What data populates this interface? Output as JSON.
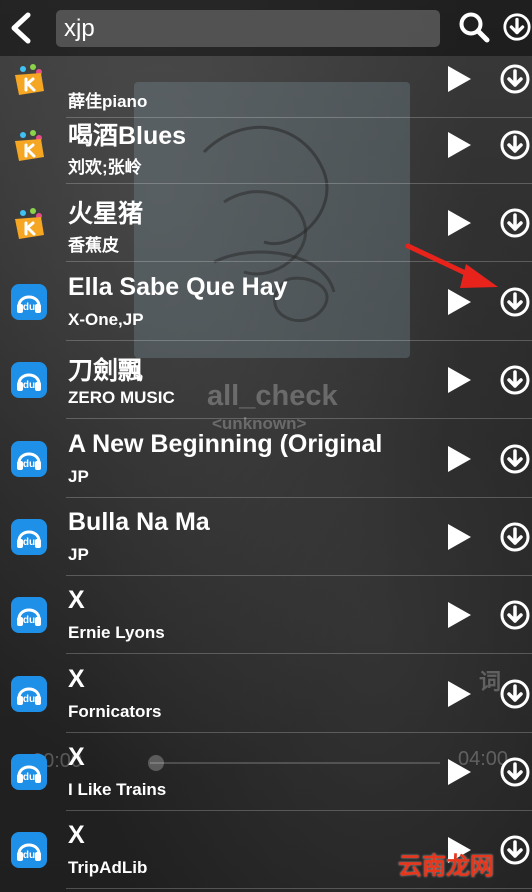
{
  "search": {
    "query": "xjp"
  },
  "songs": [
    {
      "title": "",
      "artist": "薛佳piano",
      "source": "kuwo"
    },
    {
      "title": "喝酒Blues",
      "artist": "刘欢;张岭",
      "source": "kuwo"
    },
    {
      "title": "火星猪",
      "artist": "香蕉皮",
      "source": "kuwo"
    },
    {
      "title": "Ella Sabe Que Hay",
      "artist": "X-One,JP",
      "source": "baidu"
    },
    {
      "title": "刀劍飄",
      "artist": "ZERO MUSIC",
      "source": "baidu"
    },
    {
      "title": "A New Beginning (Original",
      "artist": "JP",
      "source": "baidu"
    },
    {
      "title": "Bulla Na Ma",
      "artist": "JP",
      "source": "baidu"
    },
    {
      "title": "X",
      "artist": "Ernie Lyons",
      "source": "baidu"
    },
    {
      "title": "X",
      "artist": "Fornicators",
      "source": "baidu"
    },
    {
      "title": "X",
      "artist": "I Like Trains",
      "source": "baidu"
    },
    {
      "title": "X",
      "artist": "TripAdLib",
      "source": "baidu"
    }
  ],
  "background_player": {
    "title": "all_check",
    "subtitle": "<unknown>",
    "lyrics_label": "词",
    "time_elapsed": "00:00",
    "time_total": "04:00"
  },
  "watermark": "云南龙网",
  "colors": {
    "annotation_arrow": "#e8231c",
    "baidu_icon": "#1e90e8",
    "kuwo_icon": "#f5a623"
  }
}
